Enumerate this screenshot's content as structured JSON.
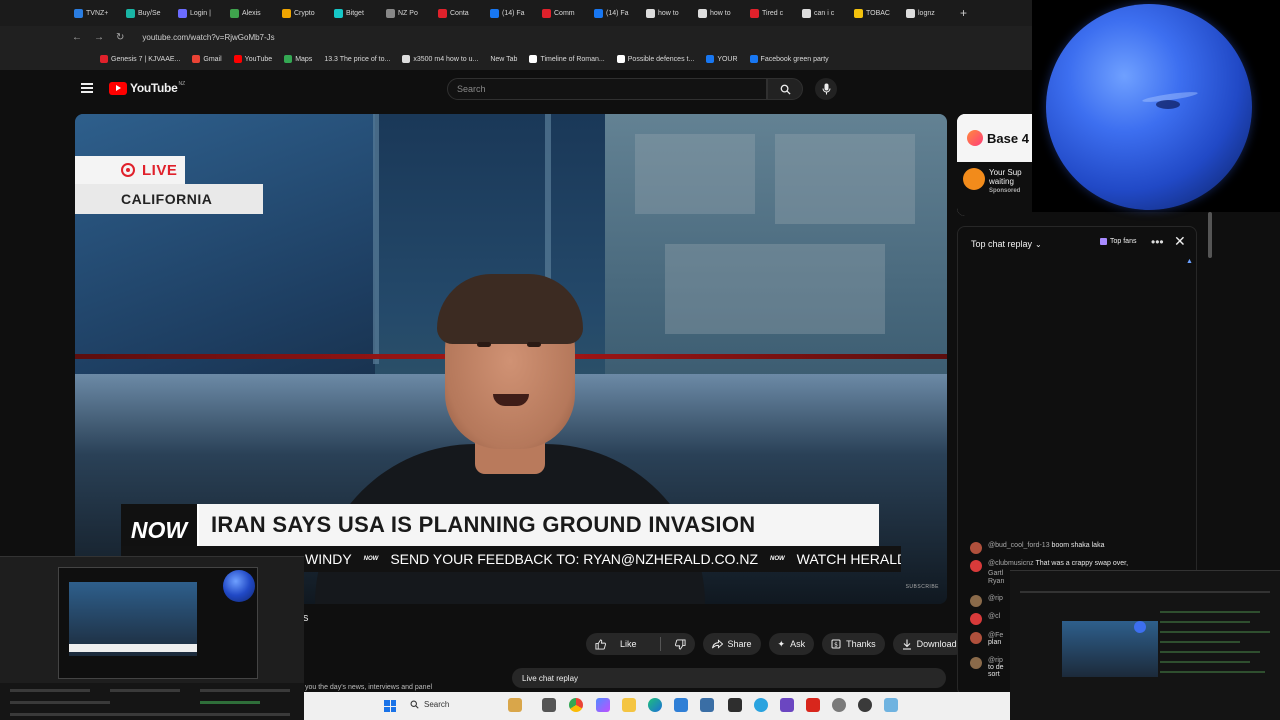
{
  "browser": {
    "tabs": [
      {
        "label": "TVNZ+",
        "color": "#2a7de1"
      },
      {
        "label": "Buy/Se",
        "color": "#19b5a5"
      },
      {
        "label": "Login |",
        "color": "#6b6bff"
      },
      {
        "label": "Alexis",
        "color": "#3fa34d"
      },
      {
        "label": "Crypto",
        "color": "#f0a500"
      },
      {
        "label": "Bitget",
        "color": "#16c7c7"
      },
      {
        "label": "NZ Po",
        "color": "#888888"
      },
      {
        "label": "Conta",
        "color": "#e0212b"
      },
      {
        "label": "(14) Fa",
        "color": "#1877f2"
      },
      {
        "label": "Comm",
        "color": "#e0212b"
      },
      {
        "label": "(14) Fa",
        "color": "#1877f2"
      },
      {
        "label": "how to",
        "color": "#dddddd"
      },
      {
        "label": "how to",
        "color": "#dddddd"
      },
      {
        "label": "Tired c",
        "color": "#e0212b"
      },
      {
        "label": "can i c",
        "color": "#dddddd"
      },
      {
        "label": "TOBAC",
        "color": "#f4c20d"
      },
      {
        "label": "lognz",
        "color": "#dddddd"
      }
    ],
    "url": "youtube.com/watch?v=RjwGoMb7-Js",
    "bookmarks": [
      {
        "label": "Genesis 7 | KJVAAE...",
        "color": "#e0212b"
      },
      {
        "label": "Gmail",
        "color": "#ea4335"
      },
      {
        "label": "YouTube",
        "color": "#ff0000"
      },
      {
        "label": "Maps",
        "color": "#34a853"
      },
      {
        "label": "13.3 The price of to...",
        "color": "#999999"
      },
      {
        "label": "x3500 m4 how to u...",
        "color": "#dddddd"
      },
      {
        "label": "New Tab",
        "color": "#666666"
      },
      {
        "label": "Timeline of Roman...",
        "color": "#ffffff"
      },
      {
        "label": "Possible defences t...",
        "color": "#ffffff"
      },
      {
        "label": "YOUR",
        "color": "#1877f2"
      },
      {
        "label": "Facebook green party",
        "color": "#1877f2"
      }
    ]
  },
  "youtube": {
    "logo_text": "YouTube",
    "region": "NZ",
    "search_placeholder": "Search"
  },
  "video": {
    "live_label": "LIVE",
    "location": "CALIFORNIA",
    "channel_logo": "NOW",
    "headline": "IRAN SAYS USA IS PLANNING GROUND INVASION",
    "ticker_start": "WINDY",
    "ticker_mid": "SEND YOUR FEEDBACK TO: RYAN@NZHERALD.CO.NZ",
    "ticker_end": "WATCH HERALD",
    "subscribe": "SUBSCRIBE"
  },
  "actions": {
    "like": "Like",
    "share": "Share",
    "ask": "Ask",
    "thanks": "Thanks",
    "download": "Download"
  },
  "below": {
    "title_fragment": "s",
    "description_fragment": "you the day's news, interviews and panel",
    "live_chat_replay": "Live chat replay"
  },
  "ad": {
    "brand": "Base 4",
    "text_line1": "Your Sup",
    "text_line2": "waiting",
    "sponsored": "Sponsored"
  },
  "chat": {
    "header": "Top chat replay",
    "top_fans": "Top fans",
    "messages": [
      {
        "author": "@bud_cool_ford-13",
        "text": "boom shaka laka",
        "color": "#b0503c"
      },
      {
        "author": "@clubmusicnz",
        "text": "That was a crappy swap over,",
        "color": "#d83a3a"
      },
      {
        "author": "Gartl",
        "text": "",
        "color": "#7a7a7a"
      },
      {
        "author": "Ryan",
        "text": "",
        "color": "#7a7a7a"
      },
      {
        "author": "@rip",
        "text": "",
        "color": "#8a6a4a"
      },
      {
        "author": "@cl",
        "text": "",
        "color": "#d83a3a"
      },
      {
        "author": "@Fe",
        "text": "plan",
        "color": "#b0503c"
      },
      {
        "author": "@rip",
        "text": "to de",
        "color": "#8a6a4a"
      },
      {
        "author": "",
        "text": "sort",
        "color": "#0f0f0f"
      }
    ]
  },
  "taskbar": {
    "search": "Search"
  }
}
